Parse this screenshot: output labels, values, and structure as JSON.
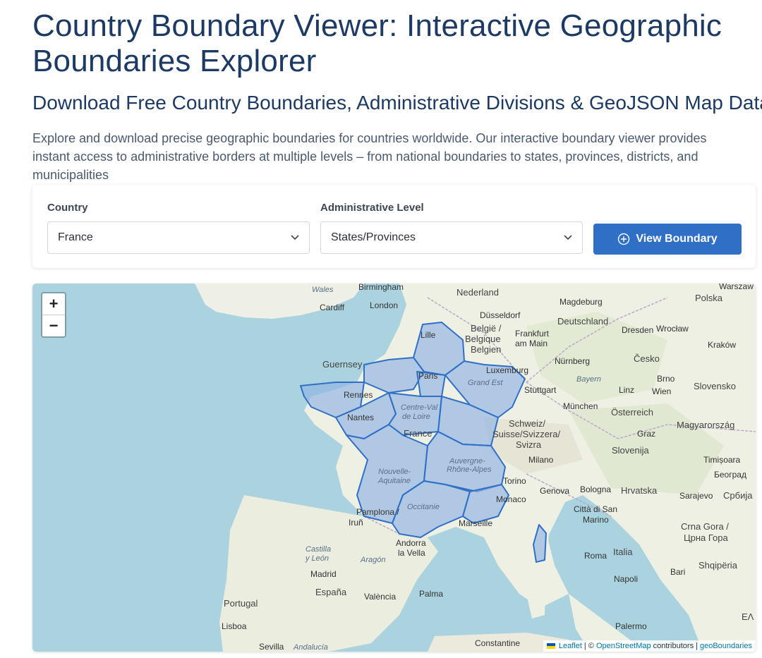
{
  "header": {
    "title": "Country Boundary Viewer: Interactive Geographic Boundaries Explorer",
    "subtitle": "Download Free Country Boundaries, Administrative Divisions & GeoJSON Map Data",
    "description": "Explore and download precise geographic boundaries for countries worldwide. Our interactive boundary viewer provides instant access to administrative borders at multiple levels – from national boundaries to states, provinces, districts, and municipalities"
  },
  "controls": {
    "country_label": "Country",
    "country_value": "France",
    "admin_label": "Administrative Level",
    "admin_value": "States/Provinces",
    "view_button": "View Boundary",
    "colors": {
      "button": "#2f6fc6",
      "boundary": "#2f6fc6"
    }
  },
  "map": {
    "zoom_in": "+",
    "zoom_out": "−",
    "attribution": {
      "leaflet": "Leaflet",
      "sep1": "| ©",
      "osm": "OpenStreetMap",
      "contributors": "contributors |",
      "geo": "geoBoundaries"
    },
    "places": {
      "wales": "Wales",
      "birmingham": "Birmingham",
      "cardiff": "Cardiff",
      "london": "London",
      "nederland": "Nederland",
      "magdeburg": "Magdeburg",
      "polska": "Polska",
      "warszawa": "Warszaw",
      "dusseldorf": "Düsseldorf",
      "deutschland": "Deutschland",
      "belgie": "België /",
      "belgique": "Belgique",
      "belgien": "Belgien",
      "frankfurt": "Frankfurt",
      "am_main": "am Main",
      "dresden": "Dresden",
      "wroclaw": "Wrocław",
      "krakow": "Kraków",
      "lille": "Lille",
      "guernsey": "Guernsey",
      "luxembourg": "Luxemburg",
      "nurnberg": "Nürnberg",
      "cesko": "Česko",
      "paris": "Paris",
      "grand_est": "Grand Est",
      "bayern": "Bayern",
      "brno": "Brno",
      "rennes": "Rennes",
      "stuttgart": "Stuttgart",
      "linz": "Linz",
      "wien": "Wien",
      "slovensko": "Slovensko",
      "centre": "Centre-Val",
      "de_loire": "de Loire",
      "munchen": "München",
      "osterreich": "Österreich",
      "nantes": "Nantes",
      "france": "France",
      "schweiz": "Schweiz/",
      "suisse": "Suisse/Svizzera/",
      "svizra": "Svizra",
      "graz": "Graz",
      "magyarorszag": "Magyarország",
      "slovenija": "Slovenija",
      "auvergne": "Auvergne-",
      "rhone": "Rhône-Alpes",
      "milano": "Milano",
      "timisoara": "Timișoara",
      "nouvelle": "Nouvelle-",
      "aquitaine": "Aquitaine",
      "torino": "Torino",
      "beograd": "Београд",
      "hrvatska": "Hrvatska",
      "genova": "Genova",
      "bologna": "Bologna",
      "sarajevo": "Sarajevo",
      "srbija": "Србија",
      "monaco": "Monaco",
      "occitanie": "Occitanie",
      "pamplona": "Pamplona /",
      "irun": "Iruñ",
      "citta": "Città di San",
      "marino": "Marino",
      "marseille": "Marseille",
      "crna_gora": "Crna Gora /",
      "tsrna": "Црна Гора",
      "castilla": "Castilla",
      "y_leon": "y León",
      "aragon": "Aragón",
      "andorra": "Andorra",
      "la_vella": "la Vella",
      "roma": "Roma",
      "italia": "Italia",
      "shqiperia": "Shqipëria",
      "madrid": "Madrid",
      "espana": "España",
      "valencia": "València",
      "palma": "Palma",
      "napoli": "Napoli",
      "bari": "Bari",
      "portugal": "Portugal",
      "lisboa": "Lisboa",
      "palermo": "Palermo",
      "sevilla": "Sevilla",
      "andalucia": "Andalucía",
      "constantine": "Constantine",
      "ell": "ΕΛ"
    }
  }
}
